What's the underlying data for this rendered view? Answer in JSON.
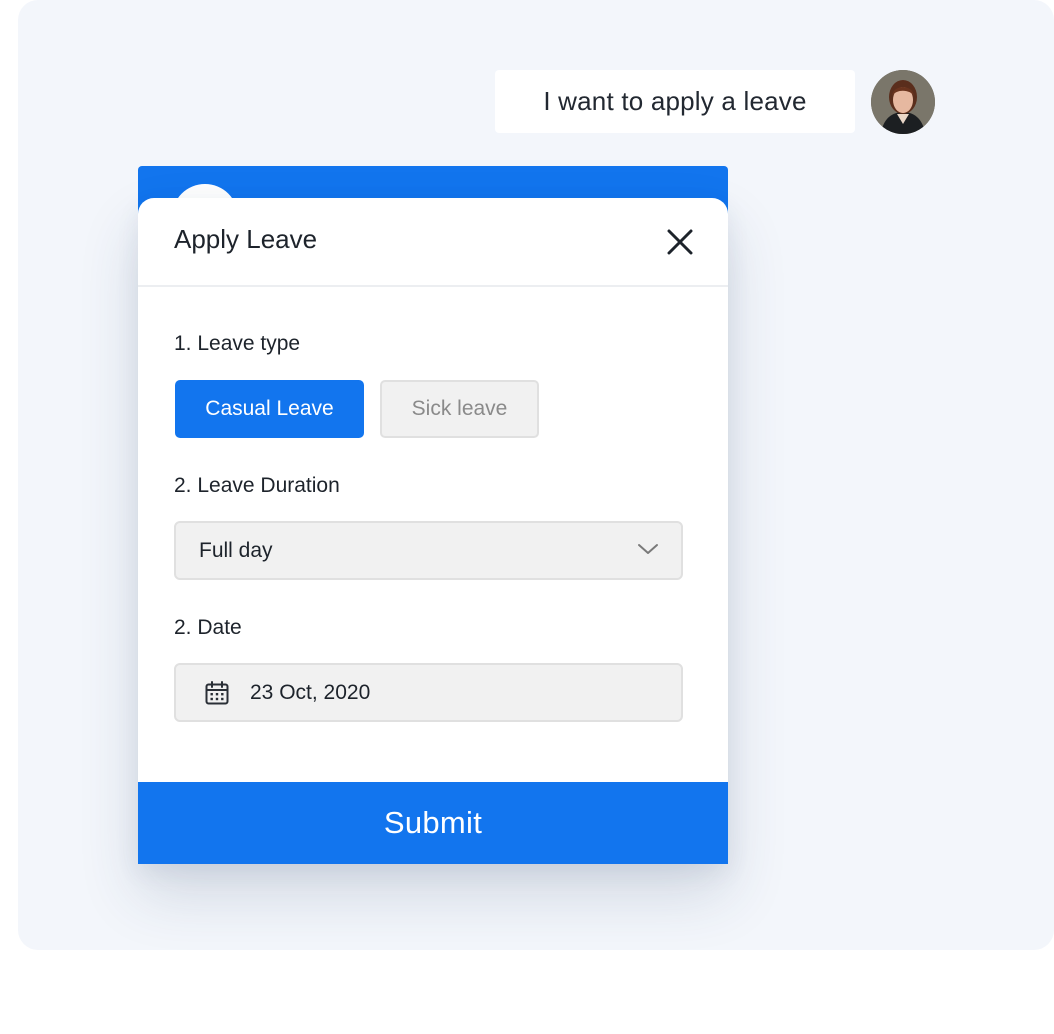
{
  "chat": {
    "user_message": "I want to apply a leave"
  },
  "modal": {
    "title": "Apply Leave",
    "leave_type": {
      "label": "1. Leave type",
      "options": [
        "Casual Leave",
        "Sick leave"
      ],
      "selected": "Casual Leave"
    },
    "duration": {
      "label": "2. Leave Duration",
      "value": "Full day"
    },
    "date": {
      "label": "2. Date",
      "value": "23 Oct, 2020"
    },
    "submit_label": "Submit"
  },
  "icons": {
    "close": "close-icon",
    "dropdown": "chevron-down-icon",
    "calendar": "calendar-icon"
  },
  "colors": {
    "accent": "#1275ee",
    "background": "#f3f6fb",
    "field_bg": "#f1f1f1"
  }
}
